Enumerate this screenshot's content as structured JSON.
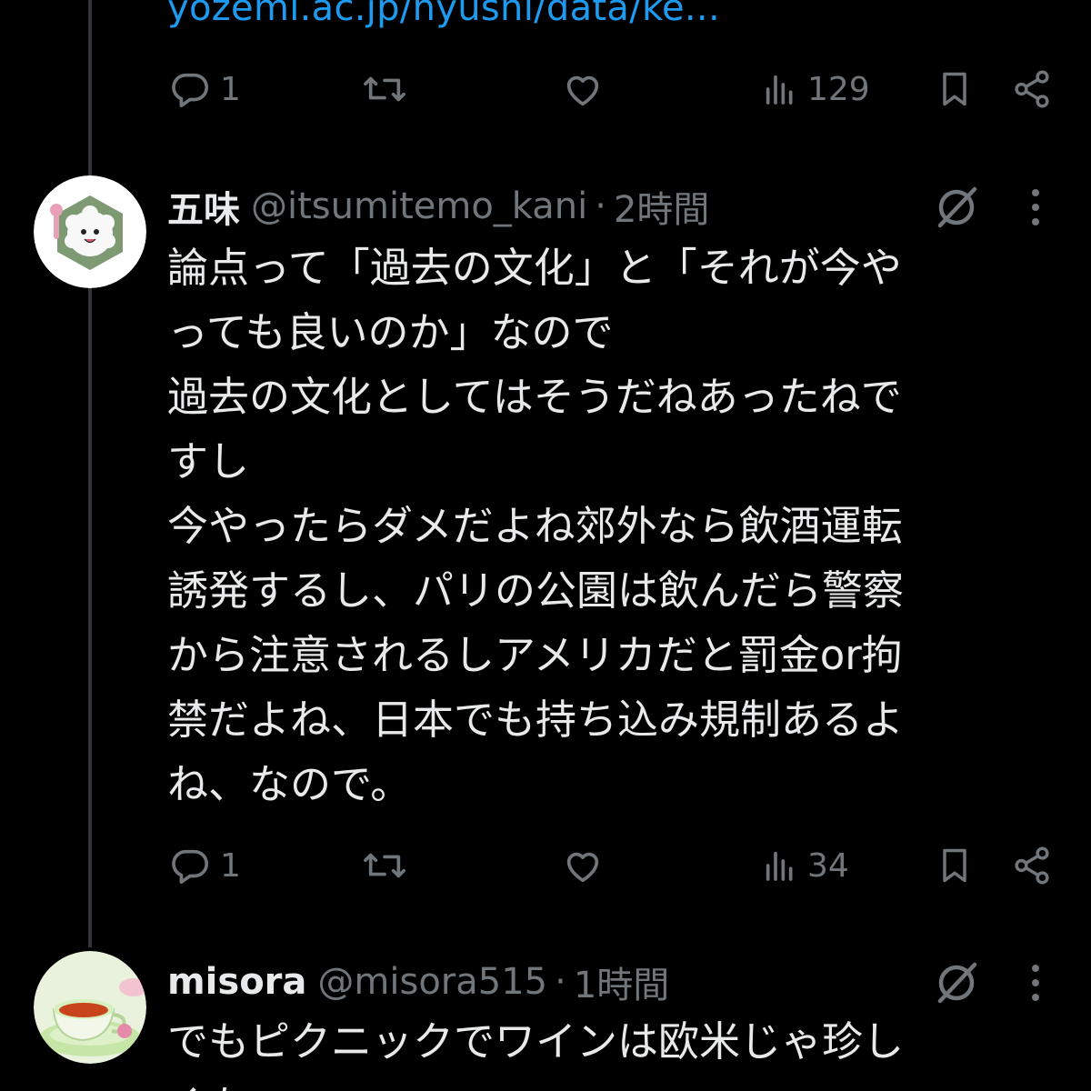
{
  "top_tweet": {
    "link_text": "yozemi.ac.jp/nyushi/data/ke...",
    "replies": "1",
    "views": "129"
  },
  "tweet1": {
    "name": "五味",
    "handle": "@itsumitemo_kani",
    "separator": "·",
    "time": "2時間",
    "lines": [
      "論点って「過去の文化」と「それが今や",
      "っても良いのか」なので",
      "過去の文化としてはそうだねあったねで",
      "すし",
      "今やったらダメだよね郊外なら飲酒運転",
      "誘発するし、パリの公園は飲んだら警察",
      "から注意されるしアメリカだと罰金or拘",
      "禁だよね、日本でも持ち込み規制あるよ",
      "ね、なので。"
    ],
    "replies": "1",
    "views": "34"
  },
  "tweet2": {
    "name": "misora",
    "handle": "@misora515",
    "separator": "·",
    "time": "1時間",
    "lines": [
      "でもピクニックでワインは欧米じゃ珍し",
      "くない"
    ]
  },
  "icons": {
    "reply": "reply-icon",
    "retweet": "retweet-icon",
    "like": "like-icon",
    "views": "views-icon",
    "bookmark": "bookmark-icon",
    "share": "share-icon",
    "grok": "grok-icon",
    "more": "more-icon"
  },
  "colors": {
    "background": "#000000",
    "text": "#e7e9ea",
    "secondary": "#71767b",
    "link": "#1d9bf0",
    "thread_line": "#333639"
  }
}
